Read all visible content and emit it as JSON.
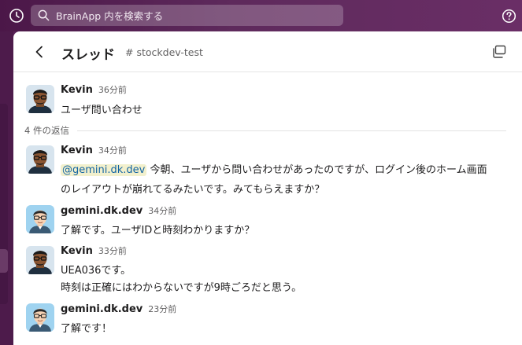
{
  "topbar": {
    "search_placeholder": "BrainApp 内を検索する"
  },
  "thread": {
    "title": "スレッド",
    "channel": "stockdev-test",
    "parent": {
      "author": "Kevin",
      "time": "36分前",
      "text": "ユーザ問い合わせ"
    },
    "reply_count": "4 件の返信",
    "replies": [
      {
        "author": "Kevin",
        "time": "34分前",
        "mention": "@gemini.dk.dev",
        "line1": " 今朝、ユーザから問い合わせがあったのですが、ログイン後のホーム画面",
        "line2": "のレイアウトが崩れてるみたいです。みてもらえますか？"
      },
      {
        "author": "gemini.dk.dev",
        "time": "34分前",
        "line1": "了解です。ユーザIDと時刻わかりますか？"
      },
      {
        "author": "Kevin",
        "time": "33分前",
        "line1": "UEA036です。",
        "line2": "時刻は正確にはわからないですが9時ごろだと思う。"
      },
      {
        "author": "gemini.dk.dev",
        "time": "23分前",
        "line1": "了解です！"
      }
    ]
  },
  "colors": {
    "topbar": "#4b1748",
    "mention_bg": "#f2f0cd",
    "mention_text": "#1264a3"
  }
}
